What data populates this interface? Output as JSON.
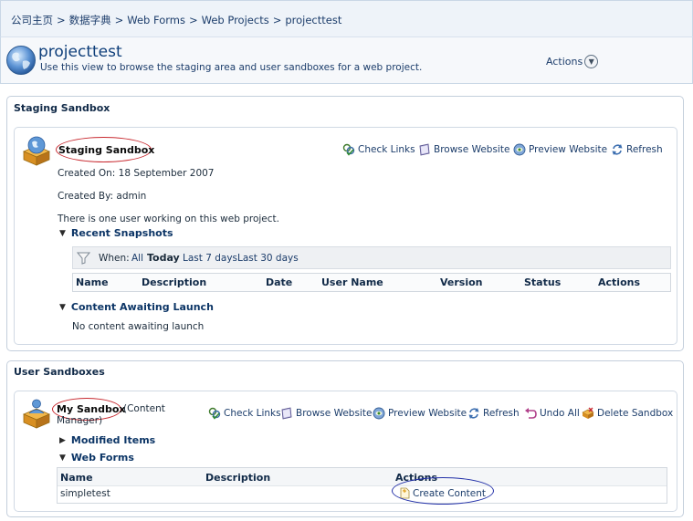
{
  "breadcrumb": {
    "items": [
      "公司主页",
      "数据字典",
      "Web Forms",
      "Web Projects",
      "projecttest"
    ],
    "separator": ">"
  },
  "header": {
    "title": "projecttest",
    "description": "Use this view to browse the staging area and user sandboxes for a web project.",
    "actions_label": "Actions",
    "icon": "globe-icon"
  },
  "staging": {
    "panel_title": "Staging Sandbox",
    "name": "Staging Sandbox",
    "created_on": "Created On: 18 September 2007",
    "created_by": "Created By: admin",
    "users_info": "There is one user working on this web project.",
    "tools": {
      "check_links": "Check Links",
      "browse_website": "Browse Website",
      "preview_website": "Preview Website",
      "refresh": "Refresh"
    },
    "recent_snapshots": {
      "title": "Recent Snapshots",
      "filter_label": "When:",
      "filters": [
        "All",
        "Today",
        "Last 7 days",
        "Last 30 days"
      ],
      "active_filter": "Today",
      "columns": [
        "Name",
        "Description",
        "Date",
        "User Name",
        "Version",
        "Status",
        "Actions"
      ]
    },
    "content_awaiting": {
      "title": "Content Awaiting Launch",
      "empty_text": "No content awaiting launch"
    }
  },
  "user_sandboxes": {
    "panel_title": "User Sandboxes",
    "name": "My Sandbox",
    "role_line1": "(Content",
    "role_line2": "Manager)",
    "tools": {
      "check_links": "Check Links",
      "browse_website": "Browse Website",
      "preview_website": "Preview Website",
      "refresh": "Refresh",
      "undo_all": "Undo All",
      "delete_sandbox": "Delete Sandbox"
    },
    "modified_items": {
      "title": "Modified Items"
    },
    "web_forms": {
      "title": "Web Forms",
      "columns": [
        "Name",
        "Description",
        "Actions"
      ],
      "rows": [
        {
          "name": "simpletest",
          "description": "",
          "action": "Create Content"
        }
      ]
    }
  },
  "colors": {
    "accent": "#0e3e7a",
    "highlight_red": "#c8292f",
    "highlight_blue": "#2230a8"
  }
}
